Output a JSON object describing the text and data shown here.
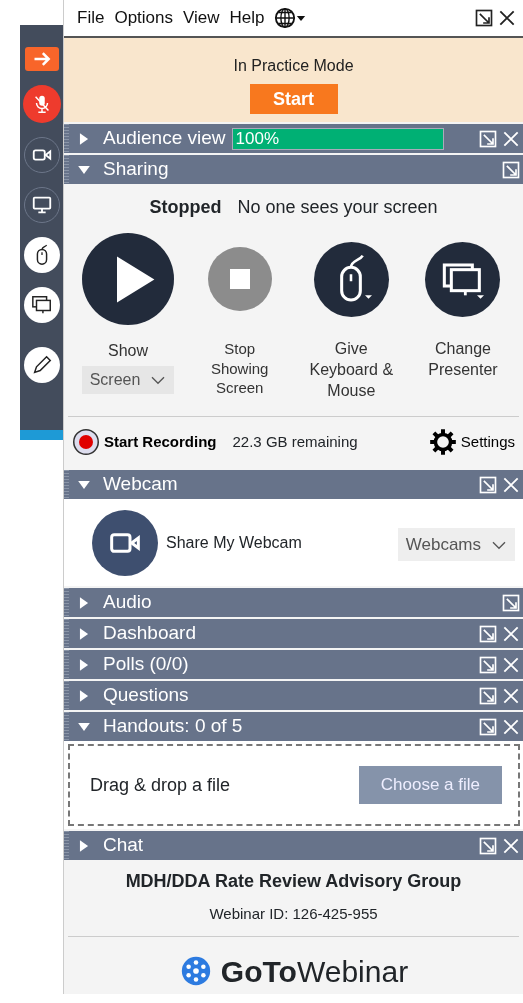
{
  "toolbar": [
    {
      "kind": "arrow"
    },
    {
      "kind": "mic"
    },
    {
      "kind": "webcam"
    },
    {
      "kind": "monitor"
    },
    {
      "kind": "mouse"
    },
    {
      "kind": "screens"
    },
    {
      "kind": "pencil"
    }
  ],
  "menu": [
    {
      "label": "File"
    },
    {
      "label": "Options"
    },
    {
      "label": "View"
    },
    {
      "label": "Help"
    }
  ],
  "practice": {
    "text": "In Practice Mode",
    "button": "Start"
  },
  "panels": [
    {
      "kind": "audience",
      "title": "Audience view",
      "expanded": false,
      "closable": true,
      "level": 1.0,
      "reading": "100%"
    },
    {
      "kind": "sharing",
      "title": "Sharing",
      "expanded": true,
      "closable": false,
      "status": "Stopped",
      "message": "No one sees your screen",
      "actions": [
        {
          "kind": "play",
          "label": "Show",
          "dropdown": "Screen",
          "disabled": false
        },
        {
          "kind": "stop",
          "label": "Stop Showing Screen",
          "disabled": true
        },
        {
          "kind": "mouse",
          "label": "Give Keyboard & Mouse",
          "disabled": false
        },
        {
          "kind": "screens",
          "label": "Change Presenter",
          "disabled": false
        }
      ],
      "recording": {
        "label": "Start Recording",
        "remaining": "22.3 GB remaining",
        "settings": "Settings"
      }
    },
    {
      "kind": "webcam",
      "title": "Webcam",
      "expanded": true,
      "closable": true,
      "label": "Share My Webcam",
      "dropdown": "Webcams"
    },
    {
      "kind": "plain",
      "title": "Audio",
      "expanded": false,
      "closable": false
    },
    {
      "kind": "plain",
      "title": "Dashboard",
      "expanded": false,
      "closable": true
    },
    {
      "kind": "plain",
      "title": "Polls (0/0)",
      "expanded": false,
      "closable": true
    },
    {
      "kind": "plain",
      "title": "Questions",
      "expanded": false,
      "closable": true
    },
    {
      "kind": "handouts",
      "title": "Handouts: 0 of 5",
      "expanded": true,
      "closable": true,
      "hint": "Drag & drop a file",
      "button": "Choose a file"
    },
    {
      "kind": "plain",
      "title": "Chat",
      "expanded": false,
      "closable": true
    }
  ],
  "footer": {
    "title": "MDH/DDA Rate Review Advisory Group",
    "webinar_id": "Webinar ID: 126-425-955",
    "logo": "**GoTo**Webinar"
  }
}
